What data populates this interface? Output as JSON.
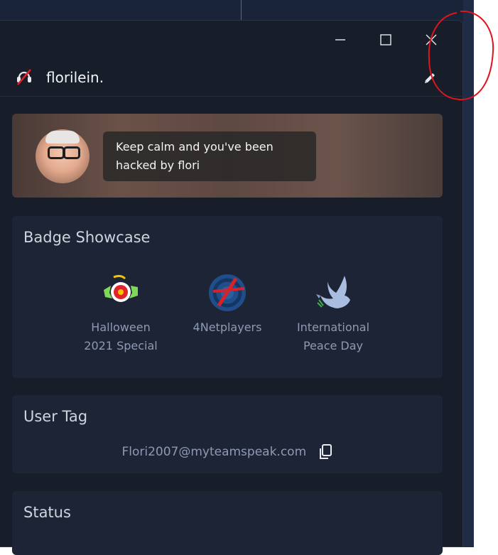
{
  "window": {
    "minimize_icon": "minimize-icon",
    "maximize_icon": "maximize-icon",
    "close_icon": "close-icon"
  },
  "header": {
    "username": "florilein.",
    "logo_icon": "muted-headset-icon",
    "edit_icon": "pencil-icon"
  },
  "profile": {
    "status_message": "Keep calm and you've been hacked by flori"
  },
  "badge_showcase": {
    "title": "Badge Showcase",
    "badges": [
      {
        "label_line1": "Halloween",
        "label_line2": "2021 Special",
        "icon": "candy-icon"
      },
      {
        "label_line1": "4Netplayers",
        "label_line2": "",
        "icon": "4netplayers-logo-icon"
      },
      {
        "label_line1": "International",
        "label_line2": "Peace Day",
        "icon": "dove-icon"
      }
    ]
  },
  "user_tag": {
    "title": "User Tag",
    "value": "Flori2007@myteamspeak.com",
    "copy_icon": "copy-icon"
  },
  "status": {
    "title": "Status"
  },
  "colors": {
    "window_bg": "#171d29",
    "card_bg": "#1d2435",
    "muted_text": "#8e9ab3",
    "annotation": "#e0141e"
  }
}
